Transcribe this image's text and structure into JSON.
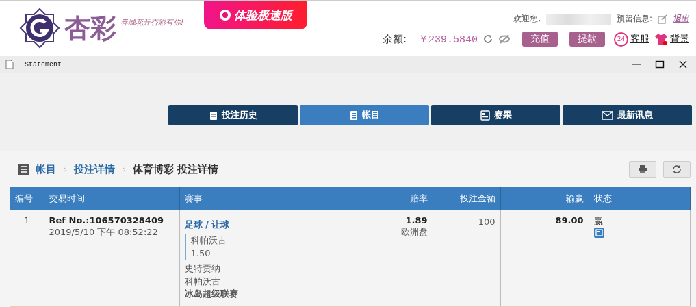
{
  "header": {
    "logo_text": "杏彩",
    "slogan": "春城花开杏彩有你!",
    "promo": "体验极速版",
    "welcome": "欢迎您,",
    "reserved_label": "预留信息:",
    "logout": "退出",
    "balance_label": "余额:",
    "balance": "￥239.5840",
    "buttons": [
      "充值",
      "提款"
    ],
    "links": [
      {
        "kind": "service",
        "label": "客服",
        "badge": "24"
      },
      {
        "kind": "theme",
        "label": "背景"
      }
    ]
  },
  "window": {
    "title": "Statement"
  },
  "tabs": [
    {
      "label": "投注历史",
      "selected": false
    },
    {
      "label": "帐目",
      "selected": true
    },
    {
      "label": "赛果",
      "selected": false
    },
    {
      "label": "最新讯息",
      "selected": false
    }
  ],
  "breadcrumb": [
    {
      "label": "帐目",
      "link": true
    },
    {
      "label": "投注详情",
      "link": true
    },
    {
      "label": "体育博彩 投注详情",
      "link": false
    }
  ],
  "table": {
    "columns": [
      "编号",
      "交易时间",
      "赛事",
      "赔率",
      "投注金额",
      "输赢",
      "状态"
    ],
    "rows": [
      {
        "no": "1",
        "ref": "Ref No.:106570328409",
        "time": "2019/5/10 下午 08:52:22",
        "sport": "足球 / 让球",
        "pick": "科帕沃古",
        "handicap": "1.50",
        "home": "史特贾纳",
        "away": "科帕沃古",
        "league": "冰岛超级联赛",
        "odds": "1.89",
        "odds_type": "欧洲盘",
        "stake": "100",
        "result": "89.00",
        "status": "赢"
      }
    ]
  }
}
